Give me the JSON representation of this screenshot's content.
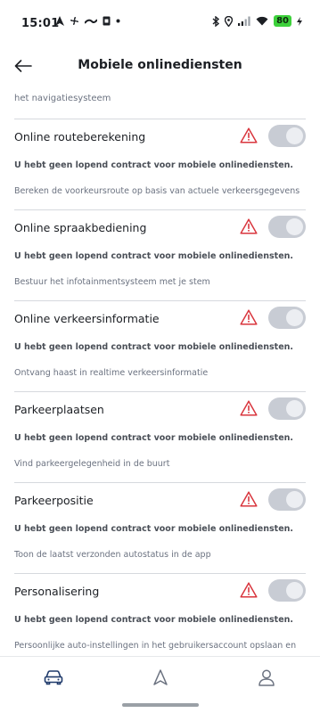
{
  "status_bar": {
    "time": "15:01",
    "battery": "80",
    "left_icons": [
      "navigation-arrow-icon",
      "fan-icon",
      "wave-icon",
      "sim-icon",
      "dot-icon"
    ],
    "right_icons": [
      "bluetooth-icon",
      "location-icon",
      "signal-icon",
      "wifi-icon",
      "battery-icon"
    ]
  },
  "header": {
    "title": "Mobiele onlinediensten",
    "back_icon": "arrow-left-icon"
  },
  "previous_item": {
    "description": "het navigatiesysteem"
  },
  "services": [
    {
      "title": "Online routeberekening",
      "message": "U hebt geen lopend contract voor mobiele onlinediensten.",
      "description": "Bereken de voorkeursroute op basis van actuele verkeersgegevens",
      "enabled": false
    },
    {
      "title": "Online spraakbediening",
      "message": "U hebt geen lopend contract voor mobiele onlinediensten.",
      "description": "Bestuur het infotainmentsysteem met je stem",
      "enabled": false
    },
    {
      "title": "Online verkeersinformatie",
      "message": "U hebt geen lopend contract voor mobiele onlinediensten.",
      "description": "Ontvang haast in realtime verkeersinformatie",
      "enabled": false
    },
    {
      "title": "Parkeerplaatsen",
      "message": "U hebt geen lopend contract voor mobiele onlinediensten.",
      "description": "Vind parkeergelegenheid in de buurt",
      "enabled": false
    },
    {
      "title": "Parkeerpositie",
      "message": "U hebt geen lopend contract voor mobiele onlinediensten.",
      "description": "Toon de laatst verzonden autostatus in de app",
      "enabled": false
    },
    {
      "title": "Personalisering",
      "message": "U hebt geen lopend contract voor mobiele onlinediensten.",
      "description": "Persoonlijke auto-instellingen in het gebruikersaccount opslaan en",
      "enabled": false
    }
  ],
  "colors": {
    "warning": "#d9363e",
    "toggle_off": "#c8ccd4",
    "nav_active": "#1f3a6b",
    "nav_inactive": "#6b7280"
  },
  "bottom_nav": {
    "items": [
      "car-icon",
      "navigation-icon",
      "profile-icon"
    ],
    "active": "car-icon"
  }
}
